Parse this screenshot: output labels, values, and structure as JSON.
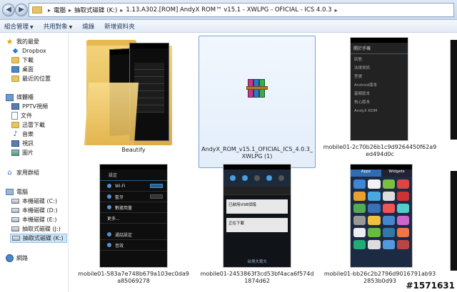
{
  "address": {
    "crumbs": [
      "電腦",
      "抽取式磁碟 (K:)",
      "1.13.A302.[ROM] AndyX ROM™ v15.1 - XWLPG - OFICIAL - ICS 4.0.3"
    ],
    "separator": "▸"
  },
  "toolbar": {
    "items": [
      "組合管理",
      "共用對象",
      "燒錄",
      "新增資料夾"
    ]
  },
  "sidebar": {
    "favorites": [
      "我的最愛",
      "Dropbox",
      "下載",
      "桌面",
      "最近的位置"
    ],
    "libraries": [
      "媒體櫃",
      "PPTV視頻",
      "文件",
      "迅雷下載",
      "音樂",
      "視訊",
      "圖片"
    ],
    "homegroup": "家用群組",
    "computer": [
      "電腦",
      "本機磁碟 (C:)",
      "本機磁碟 (D:)",
      "本機磁碟 (E:)",
      "抽取式磁碟 (J:)",
      "抽取式磁碟 (K:)"
    ],
    "network": "網路"
  },
  "files": [
    {
      "name": "Beautify"
    },
    {
      "name": "AndyX_ROM_v15.1_OFICIAL_ICS_4.0.3_XWLPG (1)"
    },
    {
      "name": "mobile01-2c70b26b1c9d9264450f62a9ed494d0c"
    },
    {
      "name": "mobile01-583a7e748b679a103ec0da9a85069278"
    },
    {
      "name": "mobile01-2453863f3cd53bf4aca6f574d1874d62"
    },
    {
      "name": "mobile01-bb26c2b2796d9016791ab932853b0d93"
    }
  ],
  "screens": {
    "about": [
      "關於手機",
      "狀態",
      "法律資訊",
      "型號",
      "Android版本",
      "基頻版本",
      "核心版本",
      "AndyX ROM"
    ],
    "settings": [
      "設定",
      "Wi-Fi",
      "藍牙",
      "數據用量",
      "更多...",
      "通話設定",
      "音效"
    ],
    "notif": [
      "已啟用USB偵錯",
      "正在下載",
      "台灣大哥大"
    ],
    "apps_tabs": [
      "Apps",
      "Widgets"
    ]
  },
  "watermark": "#1571631",
  "colors": {
    "address_bg": "#dfe9f5",
    "selection": "#cce4f7",
    "folder": "#e8c363"
  }
}
